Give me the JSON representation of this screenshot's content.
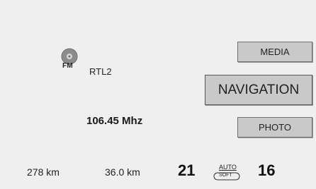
{
  "radio": {
    "band_label": "FM",
    "band_icon": "cd-disc-icon",
    "station_name": "RTL2",
    "frequency": "106.45 Mhz"
  },
  "buttons": {
    "media": "MEDIA",
    "navigation": "NAVIGATION",
    "photo": "PHOTO"
  },
  "status_bar": {
    "range_1": "278 km",
    "range_2": "36.0 km",
    "temp_left": "21",
    "climate_mode": "AUTO",
    "climate_sub_mode": "SOFT",
    "temp_right": "16"
  },
  "colors": {
    "background": "#efefef",
    "button_fill": "#c9c9c9",
    "button_border": "#6f6f6f",
    "icon_gray": "#8c8c8c"
  }
}
